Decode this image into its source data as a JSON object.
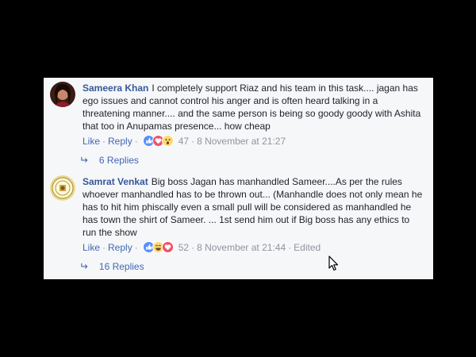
{
  "comments": [
    {
      "author": "Sameera Khan",
      "text": "I completely support Riaz and his team in this task.... jagan has ego issues and cannot control his anger and is often heard talking in a threatening manner.... and the same person is being so goody goody with Ashita that too in Anupamas presence... how cheap",
      "like_label": "Like",
      "reply_label": "Reply",
      "reaction_icons": [
        "like-icon",
        "love-icon",
        "wow-icon"
      ],
      "reaction_count": "47",
      "timestamp": "8 November at 21:27",
      "edited": "",
      "replies_label": "6 Replies"
    },
    {
      "author": "Samrat Venkat",
      "text": "Big boss Jagan has manhandled Sameer....As per the rules whoever manhandled has to be thrown out... (Manhandle does not only mean he has to hit him phiscally even a small pull will be considered as manhandled he has town the shirt of Sameer. ... 1st send him out if Big boss has any ethics to run the show",
      "like_label": "Like",
      "reply_label": "Reply",
      "reaction_icons": [
        "like-icon",
        "haha-icon",
        "love-icon"
      ],
      "reaction_count": "52",
      "timestamp": "8 November at 21:44",
      "edited": "Edited",
      "replies_label": "16 Replies"
    }
  ],
  "colors": {
    "author": "#365899",
    "link": "#4267b2",
    "meta": "#90949c",
    "panel_bg": "#f6f7f9",
    "like_blue": "#5890ff",
    "love_red": "#f25268",
    "wow_yellow": "#fcd872"
  }
}
